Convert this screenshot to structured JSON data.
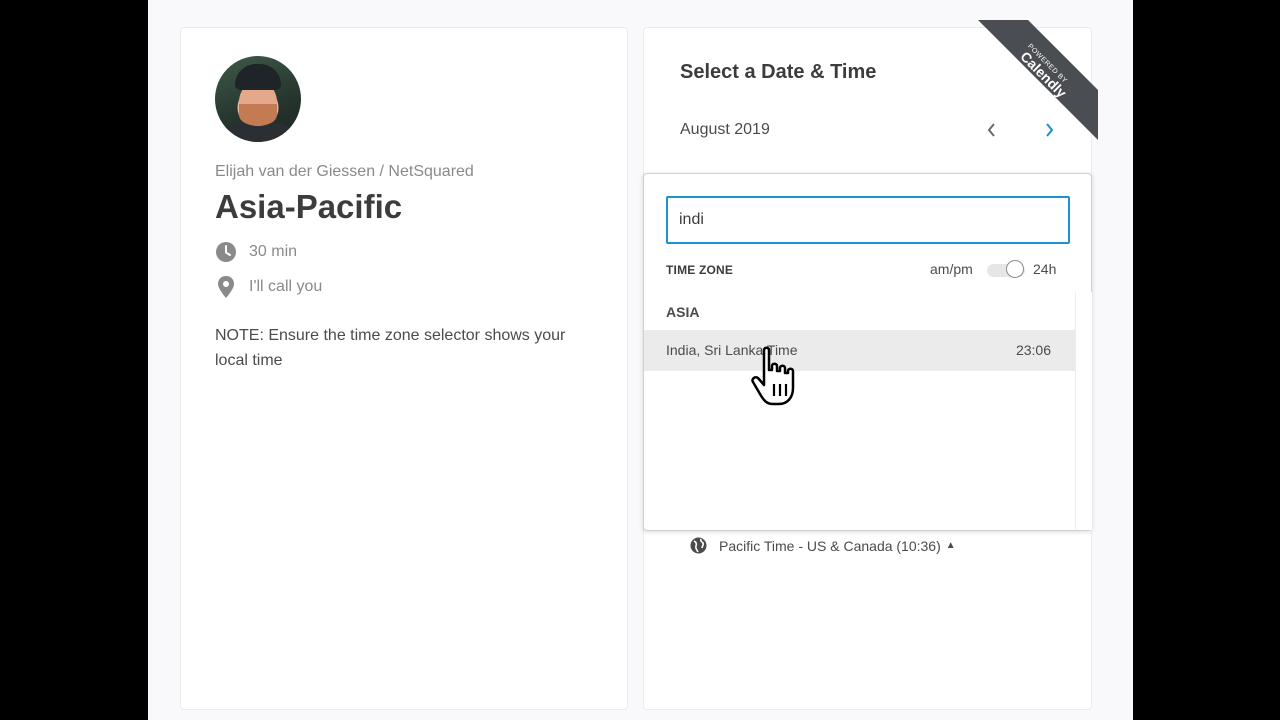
{
  "profile": {
    "owner": "Elijah van der Giessen / NetSquared",
    "event_title": "Asia-Pacific",
    "duration": "30 min",
    "location": "I'll call you",
    "note": "NOTE: Ensure the time zone selector shows your local time"
  },
  "calendar": {
    "heading": "Select a Date & Time",
    "month": "August 2019",
    "badge_line1": "POWERED BY",
    "badge_line2": "Calendly"
  },
  "timezone_picker": {
    "search_value": "indi",
    "label": "TIME ZONE",
    "ampm": "am/pm",
    "h24": "24h",
    "group": "ASIA",
    "result_name": "India, Sri Lanka Time",
    "result_time": "23:06"
  },
  "footer": {
    "current_timezone": "Pacific Time - US & Canada (10:36)",
    "caret": "▲"
  },
  "colors": {
    "accent": "#1d8fd6",
    "ribbon": "#4a4d52"
  }
}
